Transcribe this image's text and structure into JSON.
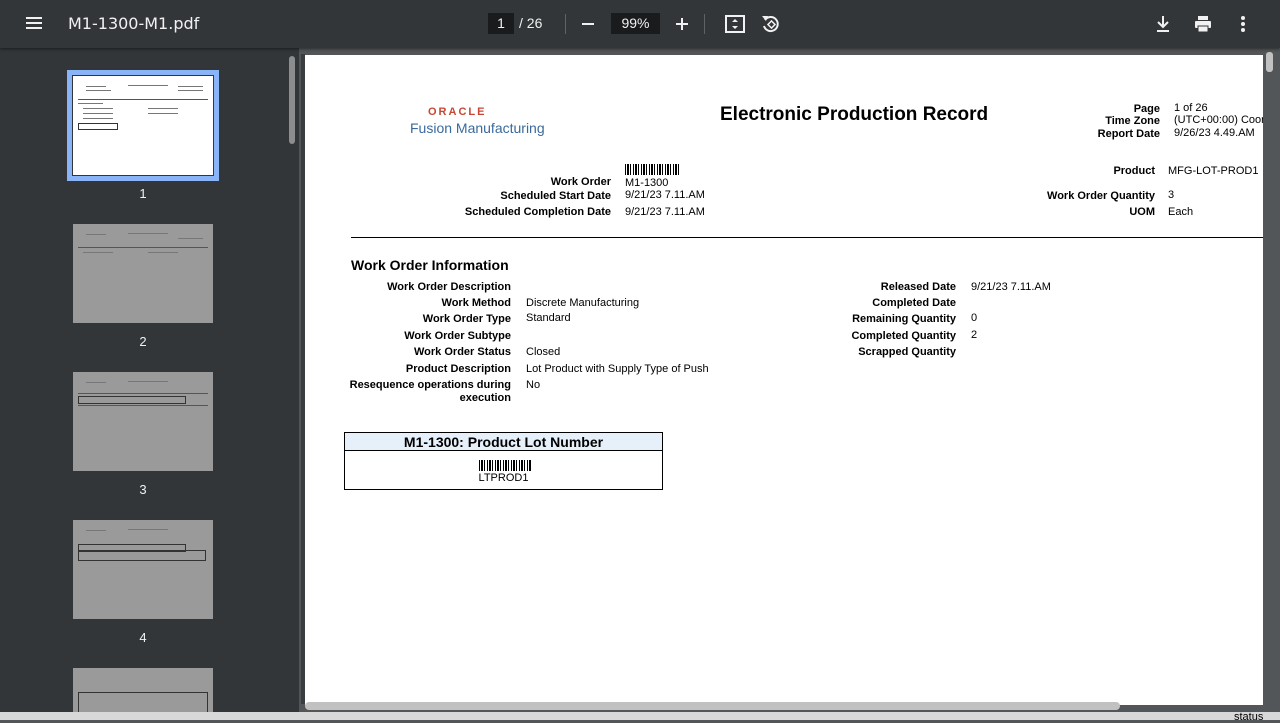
{
  "toolbar": {
    "doc_title": "M1-1300-M1.pdf",
    "current_page": "1",
    "total_pages": "/ 26",
    "zoom": "99%"
  },
  "thumbnails": [
    {
      "label": "1"
    },
    {
      "label": "2"
    },
    {
      "label": "3"
    },
    {
      "label": "4"
    }
  ],
  "doc": {
    "oracle_logo": "ORACLE",
    "fusion": "Fusion Manufacturing",
    "title": "Electronic Production Record",
    "header_right": {
      "page_label": "Page",
      "page_value": "1 of 26",
      "tz_label": "Time Zone",
      "tz_value": "(UTC+00:00) Coor",
      "report_label": "Report Date",
      "report_value": "9/26/23 4.49.AM"
    },
    "wo_header": {
      "wo_label": "Work Order",
      "wo_value": "M1-1300",
      "start_label": "Scheduled Start Date",
      "start_value": "9/21/23 7.11.AM",
      "comp_label": "Scheduled Completion Date",
      "comp_value": "9/21/23 7.11.AM",
      "product_label": "Product",
      "product_value": "MFG-LOT-PROD1",
      "qty_label": "Work Order Quantity",
      "qty_value": "3",
      "uom_label": "UOM",
      "uom_value": "Each"
    },
    "section_title": "Work Order Information",
    "left_fields": [
      {
        "label": "Work Order Description",
        "value": ""
      },
      {
        "label": "Work Method",
        "value": "Discrete Manufacturing"
      },
      {
        "label": "Work Order Type",
        "value": "Standard"
      },
      {
        "label": "Work Order Subtype",
        "value": ""
      },
      {
        "label": "Work Order Status",
        "value": "Closed"
      },
      {
        "label": "Product Description",
        "value": "Lot Product with Supply Type of Push"
      },
      {
        "label": "Resequence operations during",
        "value": "No"
      },
      {
        "label": "execution",
        "value": ""
      }
    ],
    "right_fields": [
      {
        "label": "Released Date",
        "value": "9/21/23 7.11.AM"
      },
      {
        "label": "Completed Date",
        "value": ""
      },
      {
        "label": "Remaining Quantity",
        "value": "0"
      },
      {
        "label": "Completed Quantity",
        "value": "2"
      },
      {
        "label": "Scrapped Quantity",
        "value": ""
      }
    ],
    "lot": {
      "title": "M1-1300: Product Lot Number",
      "value": "LTPROD1"
    }
  },
  "bottom": {
    "status_text": "status"
  }
}
